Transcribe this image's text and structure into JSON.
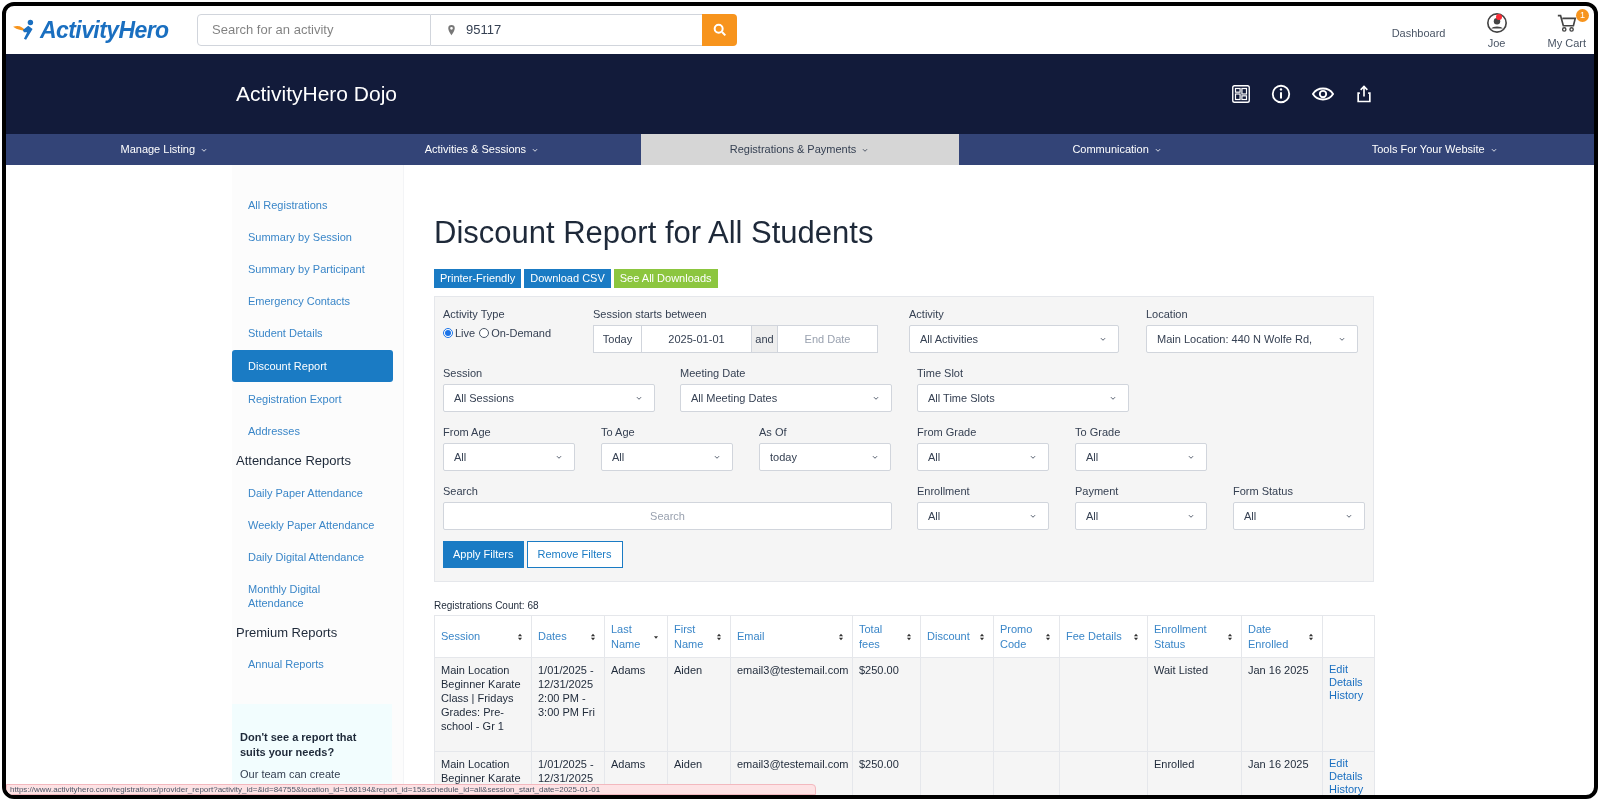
{
  "header": {
    "logo": "ActivityHero",
    "search_placeholder": "Search for an activity",
    "location": "95117",
    "links": [
      {
        "kind": "text",
        "label": "Dashboard"
      },
      {
        "kind": "user",
        "label": "Joe",
        "notification": true
      },
      {
        "kind": "cart",
        "label": "My Cart",
        "badge": "1"
      }
    ]
  },
  "banner": {
    "title": "ActivityHero Dojo"
  },
  "nav": [
    {
      "label": "Manage Listing",
      "selected": false
    },
    {
      "label": "Activities & Sessions",
      "selected": false
    },
    {
      "label": "Registrations & Payments",
      "selected": true
    },
    {
      "label": "Communication",
      "selected": false
    },
    {
      "label": "Tools For Your Website",
      "selected": false
    }
  ],
  "sidebar": {
    "groups": [
      {
        "items": [
          {
            "label": "All Registrations",
            "selected": false
          },
          {
            "label": "Summary by Session",
            "selected": false
          },
          {
            "label": "Summary by Participant",
            "selected": false
          },
          {
            "label": "Emergency Contacts",
            "selected": false
          },
          {
            "label": "Student Details",
            "selected": false
          },
          {
            "label": "Discount Report",
            "selected": true
          },
          {
            "label": "Registration Export",
            "selected": false
          },
          {
            "label": "Addresses",
            "selected": false
          }
        ]
      },
      {
        "heading": "Attendance Reports",
        "items": [
          {
            "label": "Daily Paper Attendance",
            "selected": false
          },
          {
            "label": "Weekly Paper Attendance",
            "selected": false
          },
          {
            "label": "Daily Digital Attendance",
            "selected": false
          },
          {
            "label": "Monthly Digital Attendance",
            "selected": false
          }
        ]
      },
      {
        "heading": "Premium Reports",
        "items": [
          {
            "label": "Annual Reports",
            "selected": false
          }
        ]
      }
    ],
    "promo": {
      "title": "Don't see a report that suits your needs?",
      "text": "Our team can create"
    }
  },
  "main": {
    "title": "Discount Report for All Students",
    "actions": [
      {
        "label": "Printer-Friendly",
        "color": "#1a7bc4"
      },
      {
        "label": "Download CSV",
        "color": "#1a7bc4"
      },
      {
        "label": "See All Downloads",
        "color": "#8cc63f"
      }
    ],
    "filters": [
      [
        {
          "kind": "radio",
          "label": "Activity Type",
          "options": [
            {
              "label": "Live",
              "selected": true
            },
            {
              "label": "On-Demand",
              "selected": false
            }
          ]
        },
        {
          "kind": "daterange",
          "label": "Session starts between",
          "button": "Today",
          "start": "2025-01-01",
          "joiner": "and",
          "end_placeholder": "End Date"
        },
        {
          "kind": "select",
          "label": "Activity",
          "value": "All Activities"
        },
        {
          "kind": "select",
          "label": "Location",
          "value": "Main Location: 440 N Wolfe Rd,"
        }
      ],
      [
        {
          "kind": "select",
          "label": "Session",
          "value": "All Sessions"
        },
        {
          "kind": "select",
          "label": "Meeting Date",
          "value": "All Meeting Dates"
        },
        {
          "kind": "select",
          "label": "Time Slot",
          "value": "All Time Slots"
        }
      ],
      [
        {
          "kind": "select",
          "label": "From Age",
          "value": "All"
        },
        {
          "kind": "select",
          "label": "To Age",
          "value": "All"
        },
        {
          "kind": "select",
          "label": "As Of",
          "value": "today"
        },
        {
          "kind": "select",
          "label": "From Grade",
          "value": "All"
        },
        {
          "kind": "select",
          "label": "To Grade",
          "value": "All"
        }
      ],
      [
        {
          "kind": "search",
          "label": "Search",
          "placeholder": "Search"
        },
        {
          "kind": "select",
          "label": "Enrollment",
          "value": "All"
        },
        {
          "kind": "select",
          "label": "Payment",
          "value": "All"
        },
        {
          "kind": "select",
          "label": "Form Status",
          "value": "All"
        }
      ]
    ],
    "filter_buttons": [
      {
        "label": "Apply Filters",
        "kind": "primary"
      },
      {
        "label": "Remove Filters",
        "kind": "outline"
      }
    ],
    "count": "Registrations Count: 68",
    "table": {
      "columns": [
        {
          "label": "Session",
          "sorted": false
        },
        {
          "label": "Dates",
          "sorted": false
        },
        {
          "label": "Last Name",
          "sorted": true
        },
        {
          "label": "First Name",
          "sorted": false
        },
        {
          "label": "Email",
          "sorted": false
        },
        {
          "label": "Total fees",
          "sorted": false
        },
        {
          "label": "Discount",
          "sorted": false
        },
        {
          "label": "Promo Code",
          "sorted": false
        },
        {
          "label": "Fee Details",
          "sorted": false
        },
        {
          "label": "Enrollment Status",
          "sorted": false
        },
        {
          "label": "Date Enrolled",
          "sorted": false
        }
      ],
      "rows": [
        {
          "cells": [
            "Main Location Beginner Karate Class | Fridays Grades: Pre-school - Gr 1",
            "1/01/2025 - 12/31/2025 2:00 PM - 3:00 PM Fri",
            "Adams",
            "Aiden",
            "email3@testemail.com",
            "$250.00",
            "",
            "",
            "",
            "Wait Listed",
            "Jan 16 2025"
          ],
          "links": [
            "Edit",
            "Details",
            "History"
          ]
        },
        {
          "cells": [
            "Main Location Beginner Karate",
            "1/01/2025 - 12/31/2025",
            "Adams",
            "Aiden",
            "email3@testemail.com",
            "$250.00",
            "",
            "",
            "",
            "Enrolled",
            "Jan 16 2025"
          ],
          "links": [
            "Edit",
            "Details",
            "History"
          ]
        }
      ]
    }
  },
  "status_url": "https://www.activityhero.com/registrations/provider_report?activity_id=&id=84755&location_id=168194&report_id=15&schedule_id=all&session_start_date=2025-01-01"
}
